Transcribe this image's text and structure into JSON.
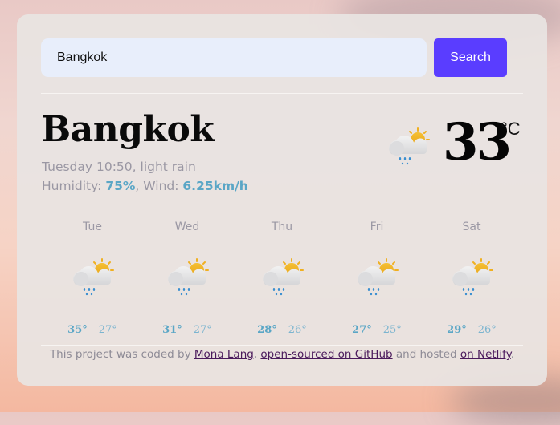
{
  "search": {
    "value": "Bangkok",
    "button_label": "Search"
  },
  "current": {
    "city": "Bangkok",
    "datetime_description": "Tuesday 10:50, light rain",
    "humidity_label": "Humidity: ",
    "humidity_value": "75%",
    "wind_label": ", Wind: ",
    "wind_value": "6.25km/h",
    "temperature": "33",
    "unit": "°C",
    "icon": "partly-cloudy-rain-icon"
  },
  "forecast": [
    {
      "day": "Tue",
      "max": "35°",
      "min": "27°",
      "icon": "partly-cloudy-rain-icon"
    },
    {
      "day": "Wed",
      "max": "31°",
      "min": "27°",
      "icon": "partly-cloudy-rain-icon"
    },
    {
      "day": "Thu",
      "max": "28°",
      "min": "26°",
      "icon": "partly-cloudy-rain-icon"
    },
    {
      "day": "Fri",
      "max": "27°",
      "min": "25°",
      "icon": "partly-cloudy-rain-icon"
    },
    {
      "day": "Sat",
      "max": "29°",
      "min": "26°",
      "icon": "partly-cloudy-rain-icon"
    }
  ],
  "footer": {
    "prefix": "This project was coded by ",
    "author_link": "Mona Lang",
    "sep": ", ",
    "github_link": "open-sourced on GitHub",
    "middle": " and hosted ",
    "netlify_link": "on Netlify",
    "suffix": "."
  },
  "colors": {
    "accent": "#5a3dff",
    "highlight": "#5aa6c6",
    "link": "#4a1a5c"
  }
}
